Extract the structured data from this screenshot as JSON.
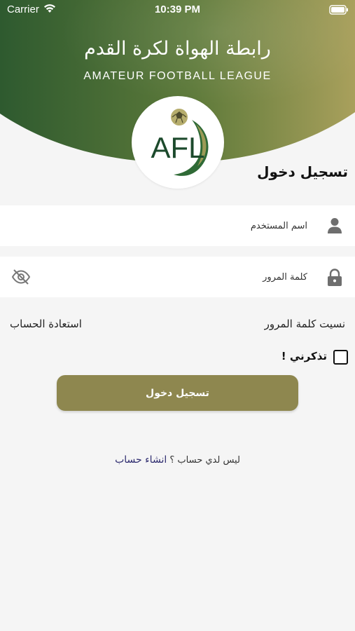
{
  "status_bar": {
    "carrier": "Carrier",
    "time": "10:39 PM",
    "wifi_icon": "wifi-icon",
    "battery_icon": "battery-full-icon"
  },
  "header": {
    "league_name_ar": "رابطة الهواة لكرة القدم",
    "league_name_en": "AMATEUR FOOTBALL LEAGUE",
    "logo_text": "AFL",
    "gradient_colors": [
      "#2e5a2f",
      "#5e7a3a",
      "#a9a05c"
    ]
  },
  "login": {
    "title": "تسجيل دخول",
    "username_placeholder": "اسم المستخدم",
    "password_placeholder": "كلمة المرور",
    "forgot_password": "نسيت كلمة المرور",
    "recover_account": "استعادة الحساب",
    "remember_me": "تذكرني !",
    "submit_label": "تسجيل دخول",
    "no_account_prompt": "ليس لدي حساب ؟",
    "create_account": "انشاء حساب"
  },
  "colors": {
    "accent": "#8e874f",
    "link": "#2c2a6e",
    "background": "#f5f5f5",
    "logo_green": "#1c4a2c"
  },
  "icons": {
    "user": "user-icon",
    "lock": "lock-icon",
    "eye": "eye-slash-icon",
    "ball": "football-icon"
  }
}
